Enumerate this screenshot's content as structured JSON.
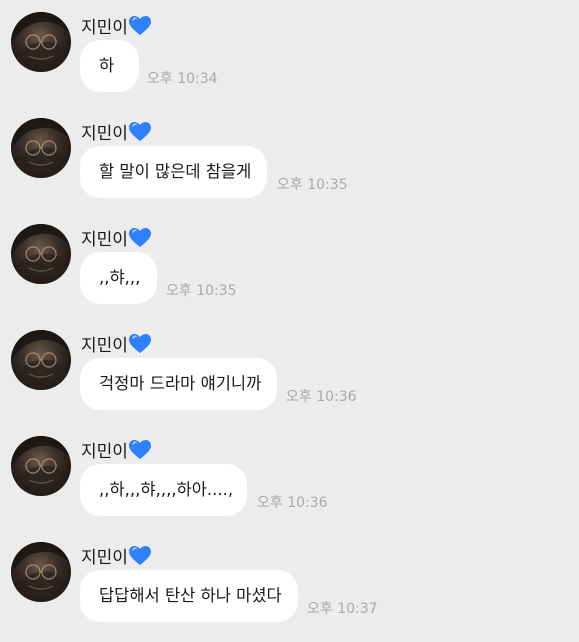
{
  "chat": {
    "messages": [
      {
        "sender": "지민이",
        "text": "하",
        "time": "오후 10:34"
      },
      {
        "sender": "지민이",
        "text": "할 말이 많은데 참을게",
        "time": "오후 10:35"
      },
      {
        "sender": "지민이",
        "text": ",,햐,,,",
        "time": "오후 10:35"
      },
      {
        "sender": "지민이",
        "text": "걱정마 드라마 얘기니까",
        "time": "오후 10:36"
      },
      {
        "sender": "지민이",
        "text": ",,하,,,햐,,,,하아....,",
        "time": "오후 10:36"
      },
      {
        "sender": "지민이",
        "text": "답답해서 탄산 하나 마셨다",
        "time": "오후 10:37"
      }
    ]
  },
  "icons": {
    "heart": "blue-heart-icon",
    "avatar": "profile-photo"
  },
  "colors": {
    "background": "#ececec",
    "bubble": "#ffffff",
    "heart": "#2f80ff",
    "timestamp": "#a9a9a9"
  }
}
